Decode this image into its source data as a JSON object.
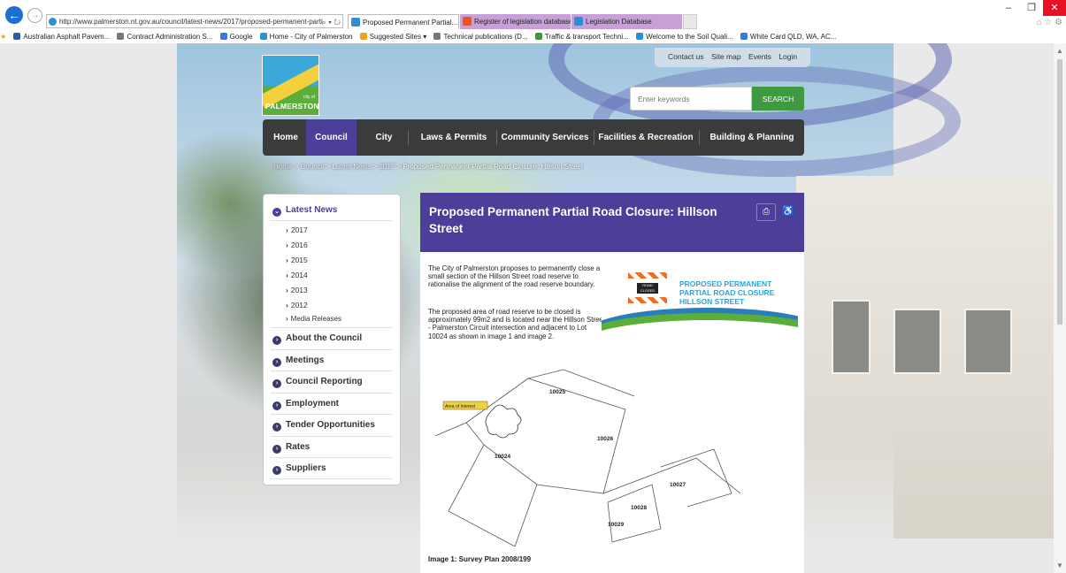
{
  "browser": {
    "address": "http://www.palmerston.nt.gov.au/council/latest-news/2017/proposed-permanent-parti",
    "address_controls": "⌕ ▾ ↻",
    "tabs": [
      {
        "label": "Proposed Permanent Partial... ×",
        "color": "#ffffff"
      },
      {
        "label": "Register of legislation database...",
        "color": "#c8a0d8"
      },
      {
        "label": "Legislation Database",
        "color": "#c8a0d8"
      }
    ],
    "window_controls": {
      "minimize": "–",
      "restore": "❐",
      "close": "✕"
    },
    "toolbar_icons": "⌂ ☆ ⚙",
    "favorites": [
      "Australian Asphalt Pavem...",
      "Contract Administration S...",
      "Google",
      "Home - City of Palmerston",
      "Suggested Sites ▾",
      "Technical publications (D...",
      "Traffic & transport Techni...",
      "Welcome to the Soil Quali...",
      "White Card QLD, WA, AC..."
    ]
  },
  "site": {
    "top_links": [
      "Contact us",
      "Site map",
      "Events",
      "Login"
    ],
    "logo": {
      "line1": "city of",
      "line2": "PALMERSTON"
    },
    "search": {
      "placeholder": "Enter keywords",
      "button": "SEARCH"
    },
    "nav": [
      "Home",
      "Council",
      "City",
      "Laws & Permits",
      "Community Services",
      "Facilities & Recreation",
      "Building & Planning"
    ],
    "nav_active": "Council",
    "breadcrumb": [
      "Home",
      "Council",
      "Latest News",
      "2017",
      "Proposed Permanent Partial Road Closure: Hillson Street"
    ],
    "breadcrumb_sep": ">"
  },
  "sidebar": {
    "active_section": "Latest News",
    "sub_items": [
      "2017",
      "2016",
      "2015",
      "2014",
      "2013",
      "2012",
      "Media Releases"
    ],
    "sections": [
      "About the Council",
      "Meetings",
      "Council Reporting",
      "Employment",
      "Tender Opportunities",
      "Rates",
      "Suppliers"
    ]
  },
  "article": {
    "title": "Proposed Permanent Partial Road Closure: Hillson Street",
    "print_icon": "⎙",
    "accessibility_icon": "♿",
    "para1": "The City of Palmerston proposes to permanently close a small section of the Hillson Street road reserve to rationalise the alignment of the road reserve boundary.",
    "para2": "The proposed area of road reserve to be closed is approximately 99m2 and is located near the Hillson Street - Palmerston Circuit intersection and adjacent to Lot 10024 as shown in image 1 and image 2.",
    "banner_text": "PROPOSED PERMANENT PARTIAL ROAD CLOSURE HILLSON STREET",
    "banner_sign": "ROAD CLOSED",
    "plan_lots": [
      "10025",
      "10026",
      "10024",
      "10027",
      "10028",
      "10029"
    ],
    "plan_label": "Area of Interest",
    "caption": "Image 1: Survey Plan 2008/199"
  },
  "colors": {
    "brand_purple": "#4b3f9a",
    "nav_dark": "#3b3b3b",
    "search_green": "#3e9a3e",
    "banner_blue": "#2aa6d6"
  }
}
